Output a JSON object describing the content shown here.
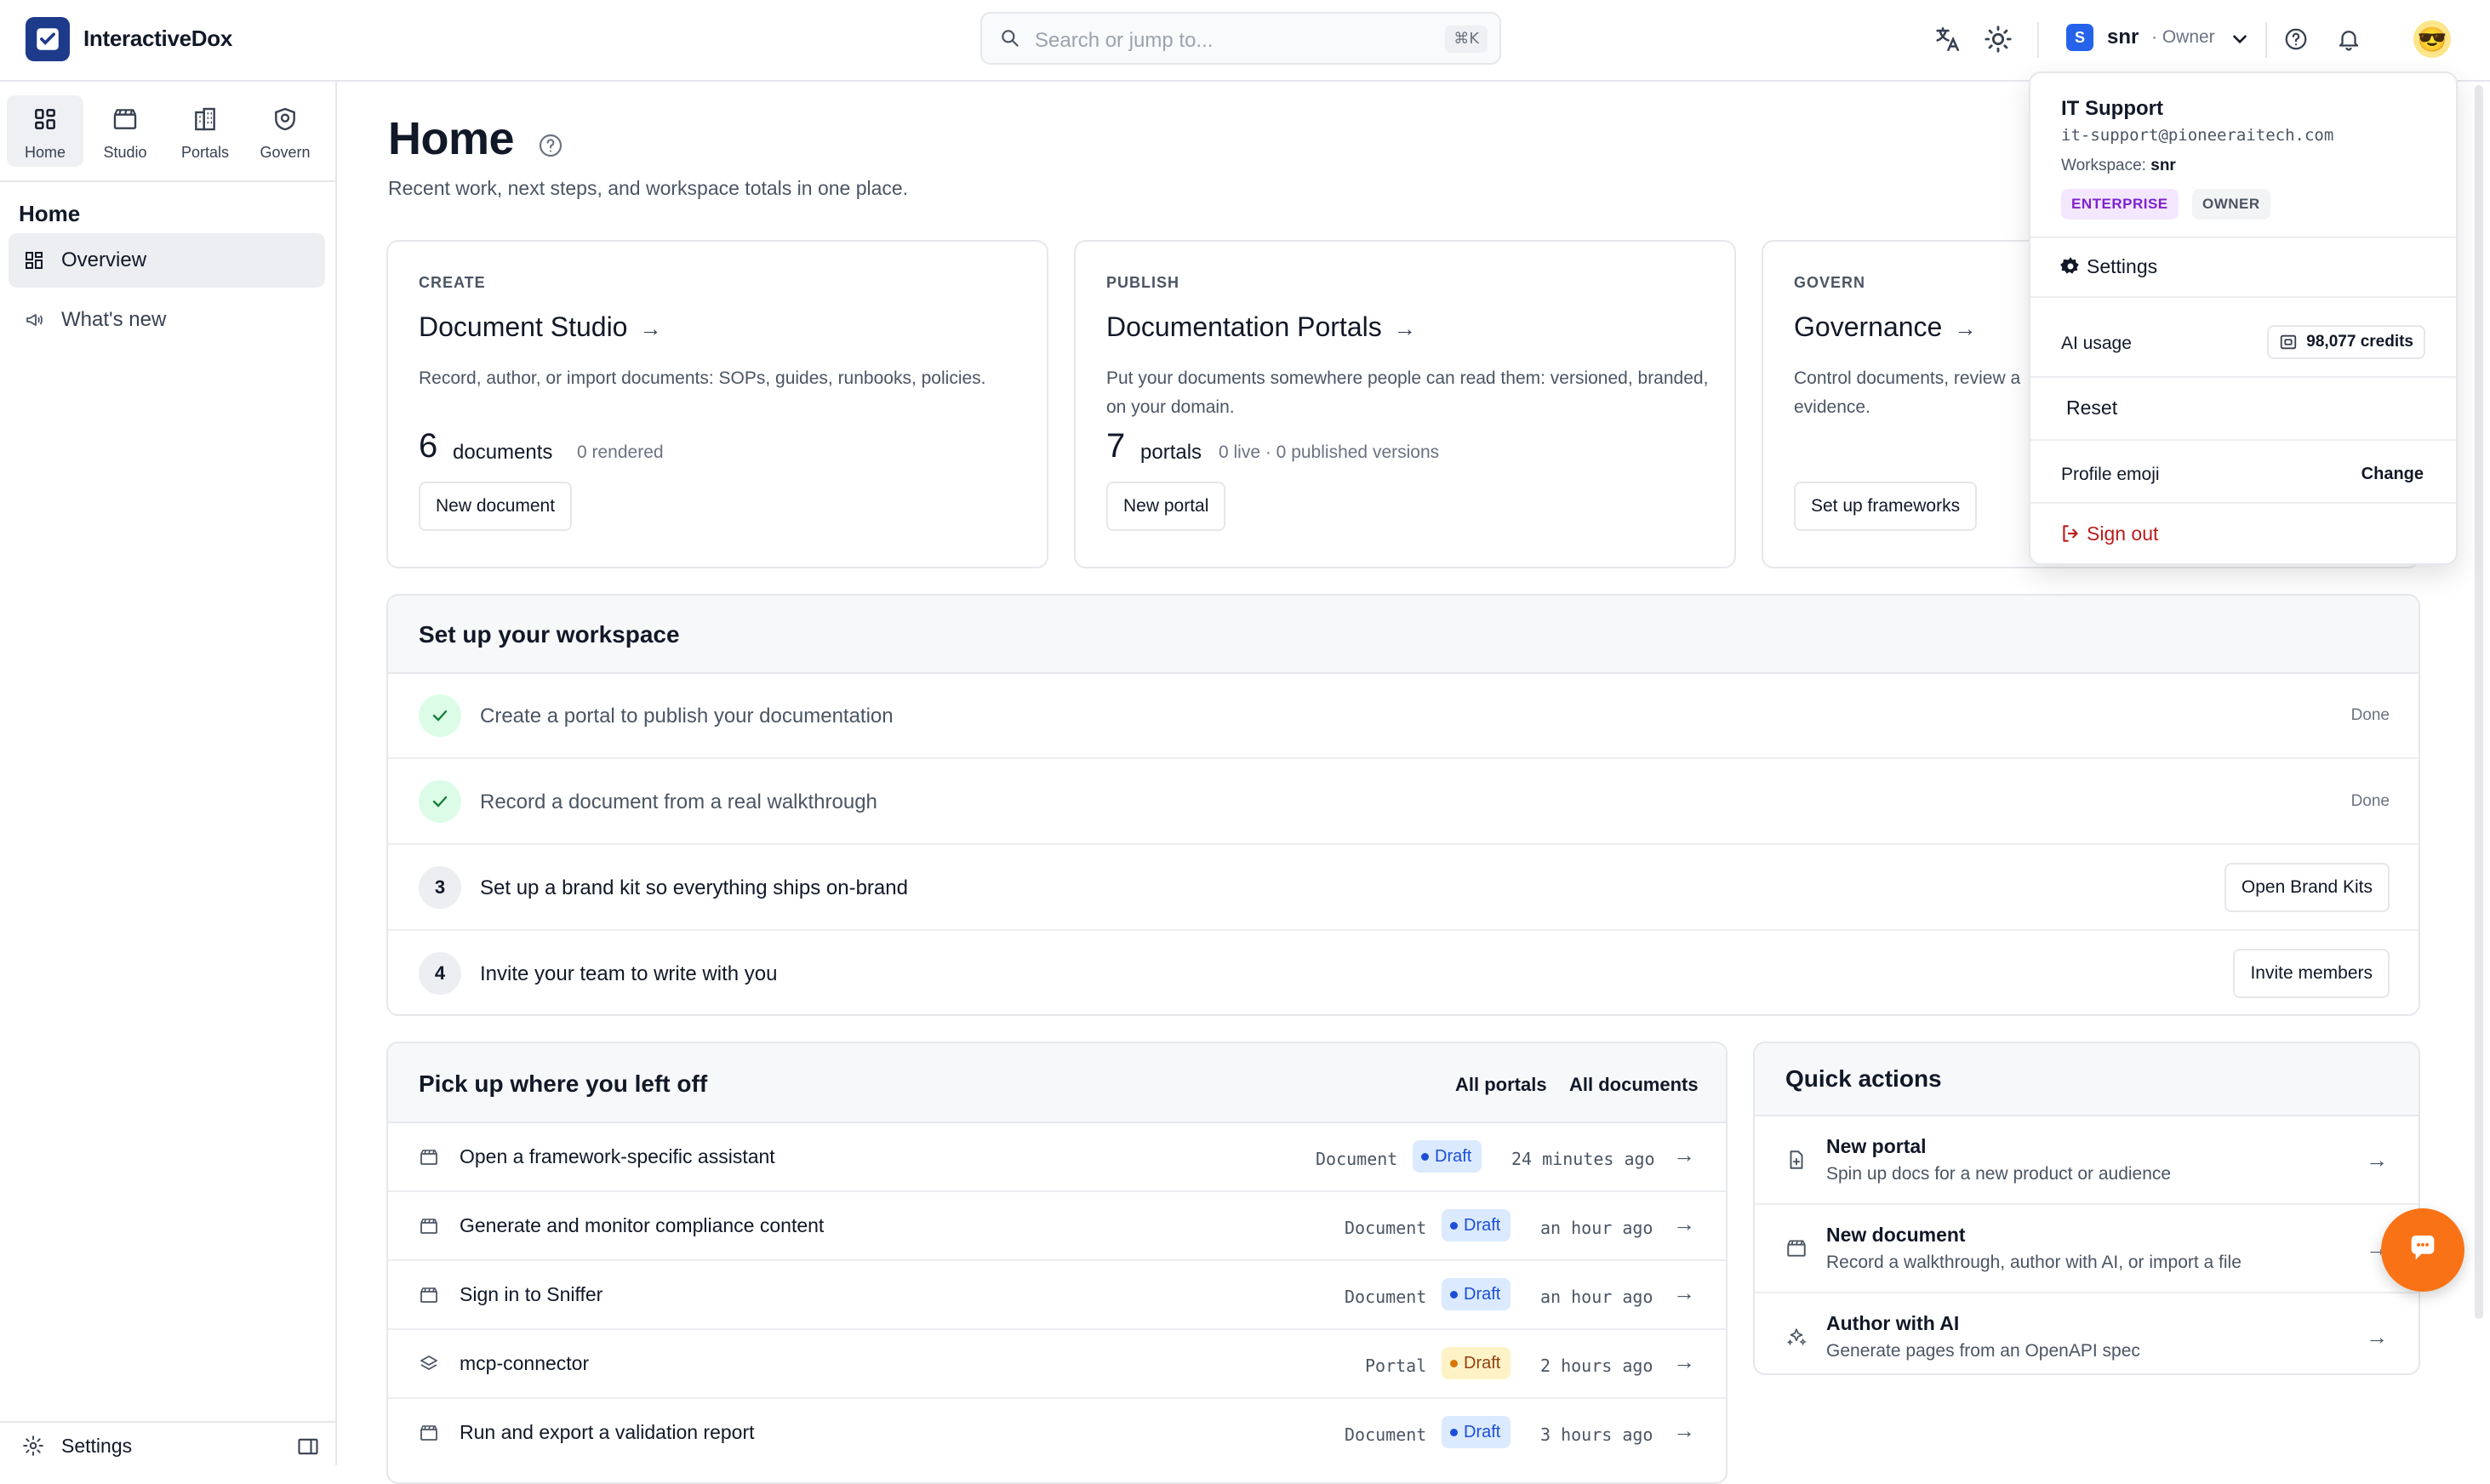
{
  "app": {
    "name": "InteractiveDox"
  },
  "search": {
    "placeholder": "Search or jump to...",
    "shortcut": "⌘K"
  },
  "workspace": {
    "initial": "S",
    "name": "snr",
    "role": "· Owner"
  },
  "avatar_emoji": "😎",
  "rail": [
    {
      "label": "Home",
      "icon": "home-grid-icon"
    },
    {
      "label": "Studio",
      "icon": "clapperboard-icon"
    },
    {
      "label": "Portals",
      "icon": "building-icon"
    },
    {
      "label": "Govern",
      "icon": "shield-icon"
    }
  ],
  "sidebar": {
    "title": "Home",
    "items": [
      {
        "label": "Overview",
        "icon": "grid-icon"
      },
      {
        "label": "What's new",
        "icon": "megaphone-icon"
      }
    ],
    "footer": {
      "settings": "Settings"
    }
  },
  "page": {
    "title": "Home",
    "subtitle": "Recent work, next steps, and workspace totals in one place."
  },
  "cards": [
    {
      "eyebrow": "CREATE",
      "title": "Document Studio",
      "desc": "Record, author, or import documents: SOPs, guides, runbooks, policies.",
      "count": "6",
      "unit": "documents",
      "meta": "0 rendered",
      "button": "New document"
    },
    {
      "eyebrow": "PUBLISH",
      "title": "Documentation Portals",
      "desc": "Put your documents somewhere people can read them: versioned, branded, on your domain.",
      "count": "7",
      "unit": "portals",
      "meta": "0 live · 0 published versions",
      "button": "New portal"
    },
    {
      "eyebrow": "GOVERN",
      "title": "Governance",
      "desc": "Control documents, review a... evidence.",
      "desc_line1": "Control documents, review a",
      "desc_line2": "evidence.",
      "button": "Set up frameworks"
    }
  ],
  "setup": {
    "title": "Set up your workspace",
    "steps": [
      {
        "num": "",
        "done": true,
        "text": "Create a portal to publish your documentation",
        "right": "Done"
      },
      {
        "num": "",
        "done": true,
        "text": "Record a document from a real walkthrough",
        "right": "Done"
      },
      {
        "num": "3",
        "done": false,
        "text": "Set up a brand kit so everything ships on-brand",
        "right": "Open Brand Kits"
      },
      {
        "num": "4",
        "done": false,
        "text": "Invite your team to write with you",
        "right": "Invite members"
      }
    ]
  },
  "recent": {
    "title": "Pick up where you left off",
    "links": [
      "All portals",
      "All documents"
    ],
    "rows": [
      {
        "name": "Open a framework-specific assistant",
        "type": "Document",
        "status": "Draft",
        "time": "24 minutes ago"
      },
      {
        "name": "Generate and monitor compliance content",
        "type": "Document",
        "status": "Draft",
        "time": "an hour ago"
      },
      {
        "name": "Sign in to Sniffer",
        "type": "Document",
        "status": "Draft",
        "time": "an hour ago"
      },
      {
        "name": "mcp-connector",
        "type": "Portal",
        "status": "Draft",
        "time": "2 hours ago"
      },
      {
        "name": "Run and export a validation report",
        "type": "Document",
        "status": "Draft",
        "time": "3 hours ago"
      }
    ]
  },
  "quick": {
    "title": "Quick actions",
    "items": [
      {
        "title": "New portal",
        "desc": "Spin up docs for a new product or audience"
      },
      {
        "title": "New document",
        "desc": "Record a walkthrough, author with AI, or import a file"
      },
      {
        "title": "Author with AI",
        "desc": "Generate pages from an OpenAPI spec"
      }
    ]
  },
  "menu": {
    "name": "IT Support",
    "email": "it-support@pioneeraitech.com",
    "workspace_label": "Workspace:",
    "workspace_value": "snr",
    "pills": [
      "ENTERPRISE",
      "OWNER"
    ],
    "settings": "Settings",
    "ai_usage": "AI usage",
    "credits": "98,077 credits",
    "reset": "Reset",
    "profile_emoji": "Profile emoji",
    "change": "Change",
    "sign_out": "Sign out"
  },
  "colors": {
    "brand": "#1e3a8a",
    "accent_orange": "#f97316",
    "draft_blue": "#1d4ed8",
    "draft_amber": "#92400e",
    "signout_red": "#b91c1c"
  }
}
